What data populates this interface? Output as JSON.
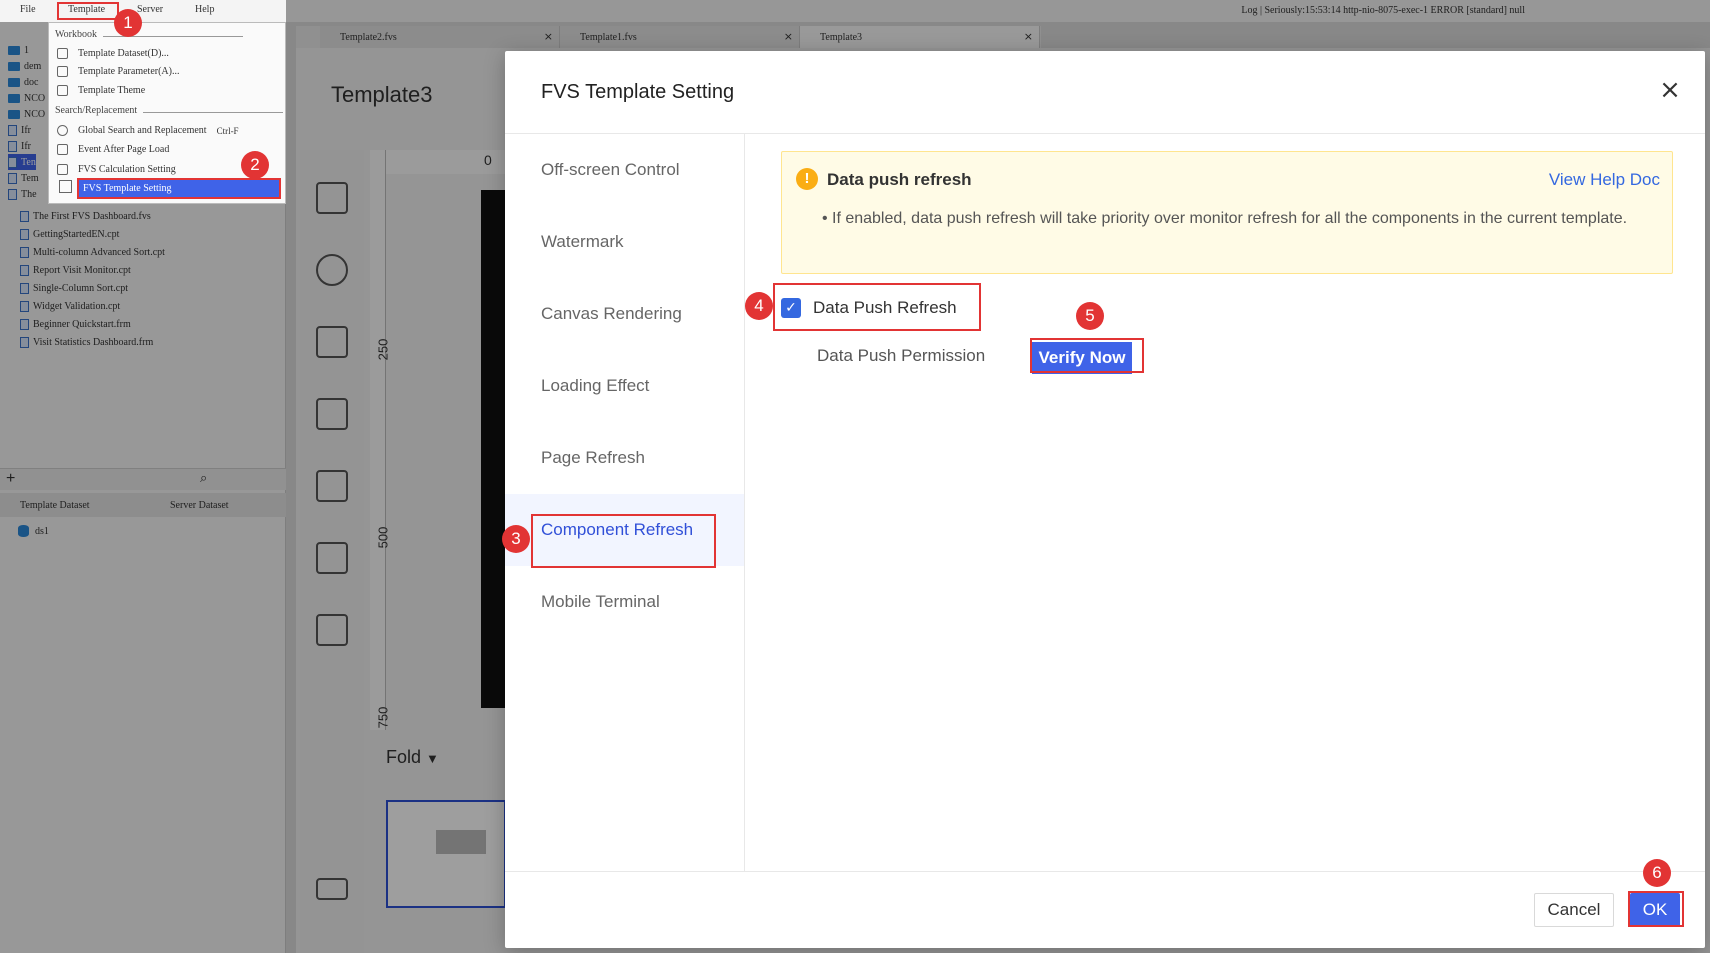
{
  "menubar": {
    "file": "File",
    "template": "Template",
    "server": "Server",
    "help": "Help"
  },
  "log_line": "Log | Seriously:15:53:14 http-nio-8075-exec-1 ERROR [standard] null",
  "template_menu": {
    "workbook_section": "Workbook",
    "items_workbook": [
      "Template Dataset(D)...",
      "Template Parameter(A)...",
      "Template Theme"
    ],
    "search_section": "Search/Replacement",
    "items_search": [
      "Global Search and Replacement",
      "Event After Page Load",
      "FVS Calculation Setting",
      "FVS Template Setting"
    ],
    "shortcut": "Ctrl-F"
  },
  "file_tree": {
    "partial_rows": [
      "1",
      "dem",
      "doc",
      "NCO",
      "NCO",
      "Ifr",
      "Ifr",
      "Ten",
      "Tem",
      "The"
    ],
    "rows": [
      "The First FVS Dashboard.fvs",
      "GettingStartedEN.cpt",
      "Multi-column Advanced Sort.cpt",
      "Report Visit Monitor.cpt",
      "Single-Column Sort.cpt",
      "Widget Validation.cpt",
      "Beginner Quickstart.frm",
      "Visit Statistics Dashboard.frm"
    ]
  },
  "dataset_tabs": {
    "template": "Template Dataset",
    "server": "Server Dataset",
    "item": "ds1"
  },
  "file_tabs": [
    "Template2.fvs",
    "Template1.fvs",
    "Template3"
  ],
  "canvas": {
    "title": "Template3",
    "fold": "Fold",
    "ruler": [
      "0",
      "250",
      "500",
      "750"
    ]
  },
  "dialog": {
    "title": "FVS Template Setting",
    "nav": [
      "Off-screen Control",
      "Watermark",
      "Canvas Rendering",
      "Loading Effect",
      "Page Refresh",
      "Component Refresh",
      "Mobile Terminal"
    ],
    "active_nav": "Component Refresh",
    "notice_icon": "!",
    "notice_title": "Data push refresh",
    "notice_help": "View Help Doc",
    "notice_body": "If enabled, data push refresh will take priority over monitor refresh for all the components in the current template.",
    "checkbox_label": "Data Push Refresh",
    "checkbox_checked": true,
    "checkmark": "✓",
    "permission_label": "Data Push Permission",
    "verify_button": "Verify Now",
    "cancel": "Cancel",
    "ok": "OK"
  },
  "markers": [
    "1",
    "2",
    "3",
    "4",
    "5",
    "6"
  ],
  "colors": {
    "accent": "#3f63e8",
    "annotation": "#e23434",
    "notice_bg": "#fffbe6",
    "notice_icon": "#faad14"
  }
}
